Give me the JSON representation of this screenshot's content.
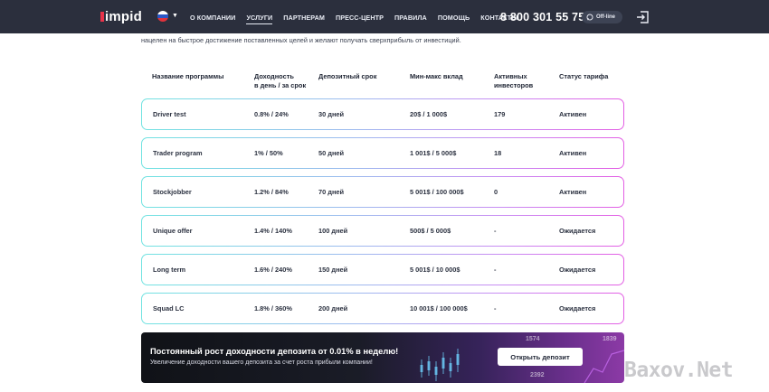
{
  "header": {
    "logo": "impid",
    "nav": [
      {
        "label": "О КОМПАНИИ",
        "active": false
      },
      {
        "label": "УСЛУГИ",
        "active": true
      },
      {
        "label": "ПАРТНЕРАМ",
        "active": false
      },
      {
        "label": "ПРЕСС-ЦЕНТР",
        "active": false
      },
      {
        "label": "ПРАВИЛА",
        "active": false
      },
      {
        "label": "ПОМОЩЬ",
        "active": false
      },
      {
        "label": "КОНТАКТЫ",
        "active": false
      }
    ],
    "phone": "8 800 301 55 75",
    "status_badge": "Off-line",
    "icons": [
      "russia-flag-icon",
      "chevron-down-icon",
      "chat-icon",
      "login-icon"
    ]
  },
  "intro": {
    "text": "нацелен на быстрое достижение поставленных целей и желают получать сверхприбыль от инвестиций."
  },
  "table": {
    "headers": [
      "Название программы",
      "Доходность\nв день / за срок",
      "Депозитный срок",
      "Мин-макс вклад",
      "Активных\nинвесторов",
      "Статус тарифа"
    ],
    "rows": [
      [
        "Driver test",
        "0.8% / 24%",
        "30 дней",
        "20$ / 1 000$",
        "179",
        "Активен"
      ],
      [
        "Trader program",
        "1% / 50%",
        "50 дней",
        "1 001$ / 5 000$",
        "18",
        "Активен"
      ],
      [
        "Stockjobber",
        "1.2% / 84%",
        "70 дней",
        "5 001$ / 100 000$",
        "0",
        "Активен"
      ],
      [
        "Unique offer",
        "1.4% / 140%",
        "100 дней",
        "500$ / 5 000$",
        "-",
        "Ожидается"
      ],
      [
        "Long term",
        "1.6% / 240%",
        "150 дней",
        "5 001$ / 10 000$",
        "-",
        "Ожидается"
      ],
      [
        "Squad LC",
        "1.8% / 360%",
        "200 дней",
        "10 001$ / 100 000$",
        "-",
        "Ожидается"
      ]
    ]
  },
  "banner": {
    "title": "Постоянный рост доходности депозита от 0.01% в неделю!",
    "subtitle": "Увеличение доходности вашего депозита за счет роста прибыли компании!",
    "button": "Открыть депозит",
    "deco_numbers": [
      "1574",
      "1839",
      "2392"
    ]
  },
  "watermark": "Baxov.Net",
  "colors": {
    "nav_bg": "#2b2f3d",
    "row_border_start": "#71e3e1",
    "row_border_end": "#e35ee4",
    "banner_accent": "#8c3aa6"
  }
}
